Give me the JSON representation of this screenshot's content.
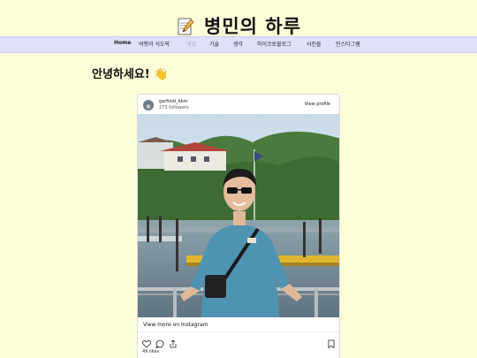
{
  "site": {
    "title": "병민의 하루",
    "title_icon": "memo-icon"
  },
  "nav": {
    "items": [
      {
        "label": "Home"
      },
      {
        "label": "여행과 식도락"
      },
      {
        "label": "게임"
      },
      {
        "label": "기술"
      },
      {
        "label": "생각"
      },
      {
        "label": "하이코로블로그"
      },
      {
        "label": "사진들"
      },
      {
        "label": "인스타그램"
      }
    ]
  },
  "main": {
    "greeting": "안녕하세요! 👋"
  },
  "instagram": {
    "username": "garfield_kbm",
    "followers": "273 followers",
    "view_profile": "View profile",
    "view_more": "View more on Instagram",
    "likes": "49 likes",
    "icons": [
      "heart-icon",
      "comment-icon",
      "share-icon",
      "bookmark-icon"
    ]
  },
  "colors": {
    "background": "#fdfdd8",
    "nav_background": "#dfe1fb",
    "active_nav": "#aaaaaa"
  }
}
